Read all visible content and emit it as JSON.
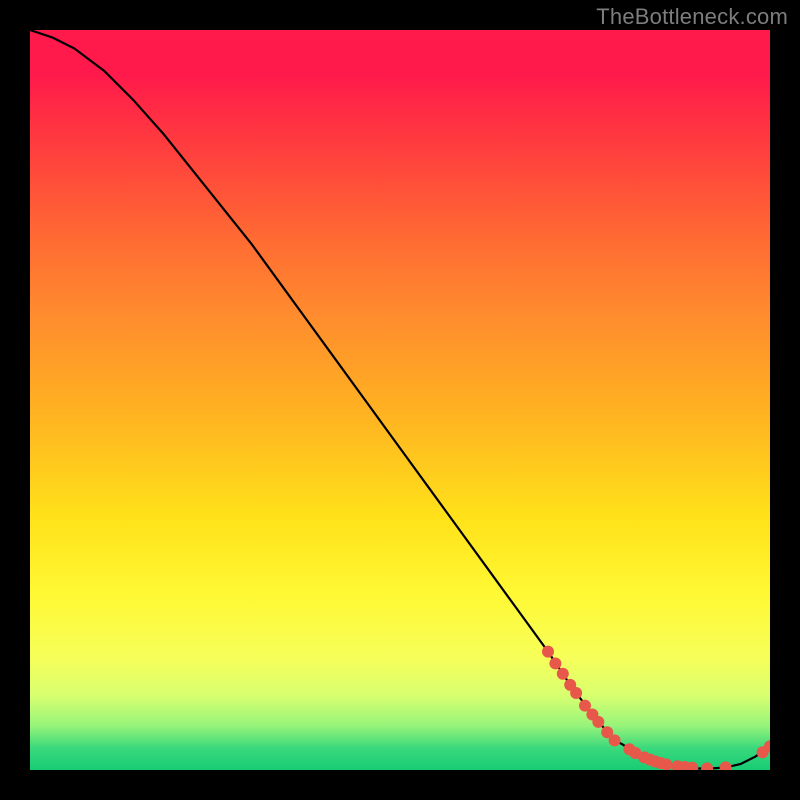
{
  "watermark": "TheBottleneck.com",
  "colors": {
    "bg": "#000000",
    "curve": "#000000",
    "marker": "#e8584a"
  },
  "chart_data": {
    "type": "line",
    "title": "",
    "xlabel": "",
    "ylabel": "",
    "xlim": [
      0,
      100
    ],
    "ylim": [
      0,
      100
    ],
    "grid": false,
    "legend": null,
    "series": [
      {
        "name": "bottleneck-curve",
        "x": [
          0,
          3,
          6,
          10,
          14,
          18,
          22,
          26,
          30,
          34,
          38,
          42,
          46,
          50,
          54,
          58,
          62,
          66,
          70,
          73,
          76,
          79,
          80,
          82,
          84,
          86,
          88,
          90,
          92,
          94,
          96,
          98,
          100
        ],
        "y": [
          100,
          99,
          97.5,
          94.5,
          90.5,
          86,
          81,
          76,
          71,
          65.5,
          60,
          54.5,
          49,
          43.5,
          38,
          32.5,
          27,
          21.5,
          16,
          11.5,
          7.5,
          4,
          3.5,
          2.2,
          1.3,
          0.7,
          0.35,
          0.2,
          0.2,
          0.35,
          0.8,
          1.8,
          3.2
        ]
      }
    ],
    "markers": [
      {
        "x": 70.0,
        "y": 16.0
      },
      {
        "x": 71.0,
        "y": 14.4
      },
      {
        "x": 72.0,
        "y": 13.0
      },
      {
        "x": 73.0,
        "y": 11.5
      },
      {
        "x": 73.8,
        "y": 10.4
      },
      {
        "x": 75.0,
        "y": 8.7
      },
      {
        "x": 76.0,
        "y": 7.5
      },
      {
        "x": 76.8,
        "y": 6.5
      },
      {
        "x": 78.0,
        "y": 5.1
      },
      {
        "x": 79.0,
        "y": 4.0
      },
      {
        "x": 81.0,
        "y": 2.8
      },
      {
        "x": 81.8,
        "y": 2.3
      },
      {
        "x": 83.0,
        "y": 1.7
      },
      {
        "x": 83.8,
        "y": 1.4
      },
      {
        "x": 84.5,
        "y": 1.15
      },
      {
        "x": 85.2,
        "y": 0.95
      },
      {
        "x": 86.0,
        "y": 0.75
      },
      {
        "x": 87.5,
        "y": 0.5
      },
      {
        "x": 88.5,
        "y": 0.4
      },
      {
        "x": 89.5,
        "y": 0.3
      },
      {
        "x": 91.5,
        "y": 0.22
      },
      {
        "x": 94.0,
        "y": 0.35
      },
      {
        "x": 99.0,
        "y": 2.4
      },
      {
        "x": 100.0,
        "y": 3.2
      }
    ]
  }
}
